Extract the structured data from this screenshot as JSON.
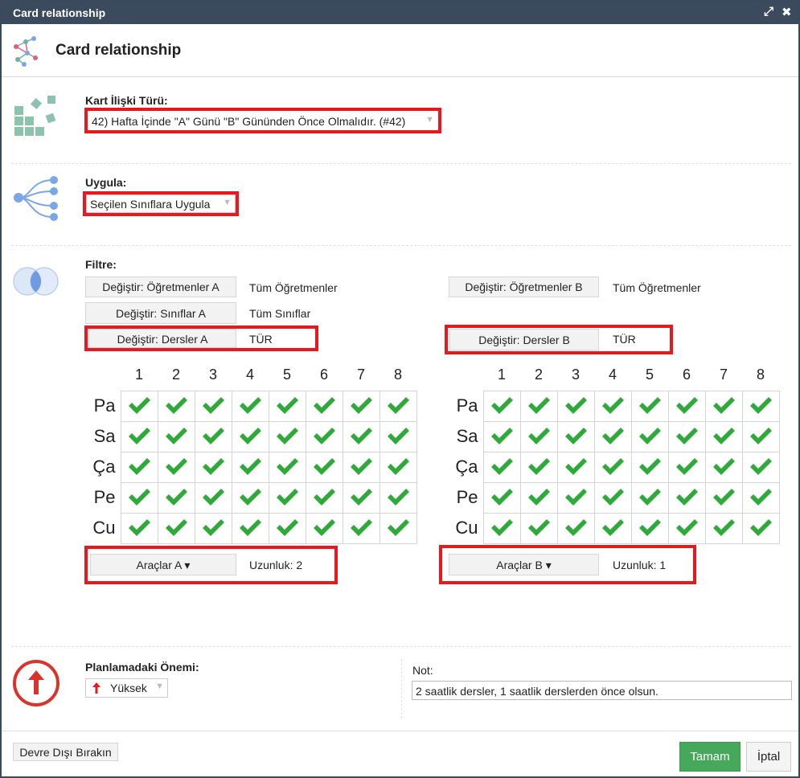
{
  "window": {
    "title": "Card relationship",
    "header_title": "Card relationship"
  },
  "relation_type": {
    "label": "Kart İlişki Türü:",
    "value": "42) Hafta İçinde \"A\" Günü \"B\" Gününden Önce Olmalıdır. (#42)"
  },
  "apply": {
    "label": "Uygula:",
    "value": "Seçilen Sınıflara Uygula"
  },
  "filter": {
    "label": "Filtre:",
    "a": {
      "teachers_button": "Değiştir: Öğretmenler A",
      "teachers_value": "Tüm Öğretmenler",
      "classes_button": "Değiştir: Sınıflar A",
      "classes_value": "Tüm Sınıflar",
      "subjects_button": "Değiştir: Dersler A",
      "subjects_value": "TÜR"
    },
    "b": {
      "teachers_button": "Değiştir: Öğretmenler B",
      "teachers_value": "Tüm Öğretmenler",
      "subjects_button": "Değiştir: Dersler B",
      "subjects_value": "TÜR"
    }
  },
  "grid": {
    "periods": [
      "1",
      "2",
      "3",
      "4",
      "5",
      "6",
      "7",
      "8"
    ],
    "days": [
      "Pa",
      "Sa",
      "Ça",
      "Pe",
      "Cu"
    ],
    "all_checked": true,
    "check_color": "#2eaa3a"
  },
  "tools": {
    "a_button": "Araçlar A ▾",
    "a_length": "Uzunluk: 2",
    "b_button": "Araçlar B ▾",
    "b_length": "Uzunluk: 1"
  },
  "importance": {
    "label": "Planlamadaki Önemi:",
    "value": "Yüksek",
    "icon": "red-up-arrow-icon"
  },
  "note": {
    "label": "Not:",
    "value": "2 saatlik dersler, 1 saatlik derslerden önce olsun."
  },
  "footer": {
    "disable_button": "Devre Dışı Bırakın",
    "ok_button": "Tamam",
    "cancel_button": "İptal"
  },
  "colors": {
    "titlebar": "#3b4a5c",
    "highlight_border": "#e8181e",
    "ok_button": "#45a85a",
    "icon_teal": "#6fb39d",
    "icon_blue": "#7aa7e6",
    "importance_red": "#d9342b"
  }
}
